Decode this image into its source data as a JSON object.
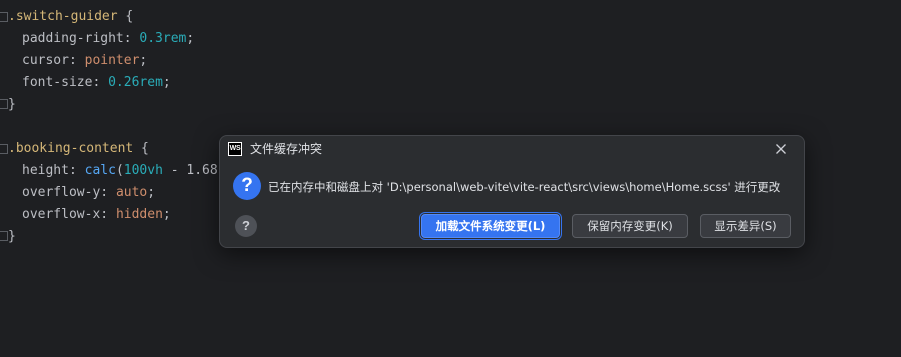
{
  "editor": {
    "rule1": {
      "selector": ".switch-guider",
      "open_brace": " {",
      "decls": [
        {
          "prop": "padding-right",
          "value": "0.3rem"
        },
        {
          "prop": "cursor",
          "value": "pointer"
        },
        {
          "prop": "font-size",
          "value": "0.26rem"
        }
      ],
      "close_brace": "}"
    },
    "rule2": {
      "selector": ".booking-content",
      "open_brace": " {",
      "line1_prop": "height",
      "line1_fn": "calc",
      "line1_arg": "100vh",
      "line1_rest": " - 1.68",
      "line2_prop": "overflow-y",
      "line2_value": "auto",
      "line3_prop": "overflow-x",
      "line3_value": "hidden",
      "close_brace": "}"
    }
  },
  "dialog": {
    "title": "文件缓存冲突",
    "logo_text": "WS",
    "message": "已在内存中和磁盘上对 'D:\\personal\\web-vite\\vite-react\\src\\views\\home\\Home.scss' 进行更改",
    "help_label": "?",
    "question_glyph": "?",
    "buttons": {
      "load_fs": "加载文件系统变更(L)",
      "keep_memory": "保留内存变更(K)",
      "show_diff": "显示差异(S)"
    }
  }
}
